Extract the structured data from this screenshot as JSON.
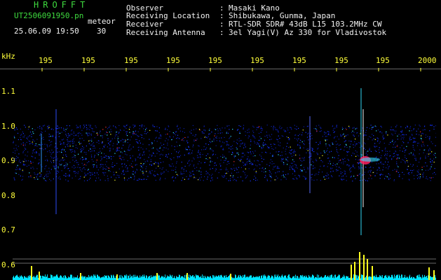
{
  "header": {
    "brand": "HROFFT",
    "file": "UT2506091950.pn",
    "tag": "meteor",
    "date": "25.06.09 19:50",
    "value": "30"
  },
  "metadata": [
    {
      "label": "Observer",
      "value": "Masaki Kano"
    },
    {
      "label": "Receiving Location",
      "value": "Shibukawa, Gunma, Japan"
    },
    {
      "label": "Receiver",
      "value": "RTL-SDR SDR# 43dB L15 103.2MHz CW"
    },
    {
      "label": "Receiving Antenna",
      "value": "3el Yagi(V) Az 330 for Vladivostok"
    }
  ],
  "y_axis": {
    "unit": "kHz",
    "ticks": [
      "1.1",
      "1.0",
      "0.9",
      "0.8",
      "0.7",
      "0.6"
    ]
  },
  "x_axis": {
    "ticks": [
      "195",
      "195",
      "195",
      "195",
      "195",
      "195",
      "195",
      "195",
      "195",
      "2000"
    ]
  },
  "colors": {
    "label_green": "#3fdc3f",
    "text_white": "#f2f2f2",
    "tick_yellow": "#ffff3a",
    "band_blue": "#0a1fd0",
    "trace_cyan": "#00e5ff",
    "peak_yellow": "#ffff20"
  }
}
